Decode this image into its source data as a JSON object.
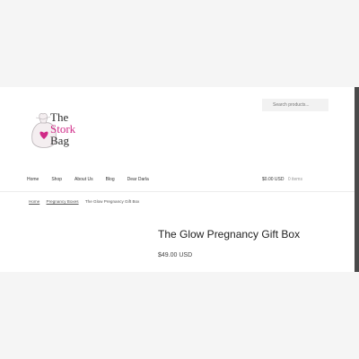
{
  "search": {
    "placeholder": "Search products..."
  },
  "logo": {
    "line1": "The",
    "line2": "Stork",
    "line3": "Bag"
  },
  "nav": {
    "items": [
      "Home",
      "Shop",
      "About Us",
      "Blog",
      "Dear Darla"
    ]
  },
  "cart": {
    "total": "$0.00 USD",
    "count": "0 items"
  },
  "breadcrumb": {
    "home": "Home",
    "category": "Pregnancy Boxes",
    "current": "The Glow Pregnancy Gift Box"
  },
  "product": {
    "title": "The Glow Pregnancy Gift Box",
    "price": "$49.00 USD"
  },
  "colors": {
    "brand_pink": "#d02a87",
    "background": "#f5f5f5"
  }
}
